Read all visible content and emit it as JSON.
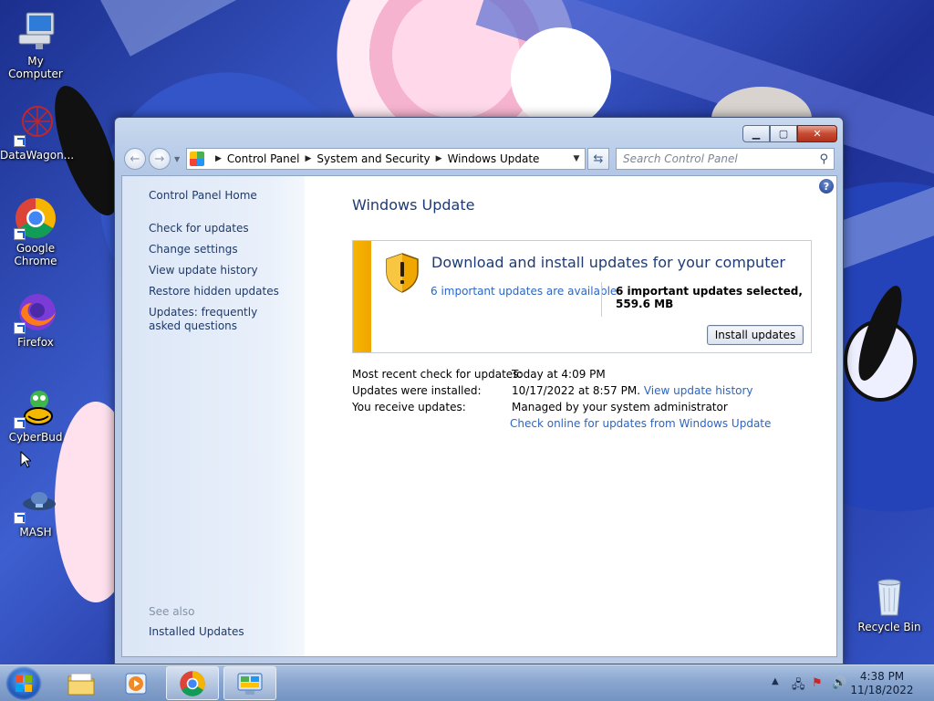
{
  "desktop": {
    "icons": [
      {
        "label": "My Computer"
      },
      {
        "label": "DataWagon..."
      },
      {
        "label": "Google Chrome"
      },
      {
        "label": "Firefox"
      },
      {
        "label": "CyberBud"
      },
      {
        "label": "MASH"
      },
      {
        "label": "Recycle Bin"
      }
    ]
  },
  "window": {
    "controls": {
      "minimize": "▁",
      "maximize": "▢",
      "close": "✕"
    },
    "address": {
      "crumbs": [
        "Control Panel",
        "System and Security",
        "Windows Update"
      ]
    },
    "search": {
      "placeholder": "Search Control Panel"
    },
    "left_pane": {
      "home": "Control Panel Home",
      "links": [
        "Check for updates",
        "Change settings",
        "View update history",
        "Restore hidden updates",
        "Updates: frequently asked questions"
      ],
      "see_also": "See also",
      "see_also_links": [
        "Installed Updates"
      ]
    },
    "main": {
      "title": "Windows Update",
      "panel": {
        "heading": "Download and install updates for your computer",
        "available_link": "6 important updates are available",
        "selected": "6 important updates selected, 559.6 MB",
        "install_button": "Install updates",
        "accent_color": "#f7b500"
      },
      "info": {
        "recent_check_label": "Most recent check for updates:",
        "recent_check_value": "Today at 4:09 PM",
        "installed_label": "Updates were installed:",
        "installed_value": "10/17/2022 at 8:57 PM.",
        "history_link": "View update history",
        "receive_label": "You receive updates:",
        "receive_value": "Managed by your system administrator",
        "online_link": "Check online for updates from Windows Update"
      }
    }
  },
  "taskbar": {
    "items": [
      "windows-explorer",
      "media-player",
      "google-chrome",
      "control-panel"
    ],
    "clock": {
      "time": "4:38 PM",
      "date": "11/18/2022"
    }
  }
}
